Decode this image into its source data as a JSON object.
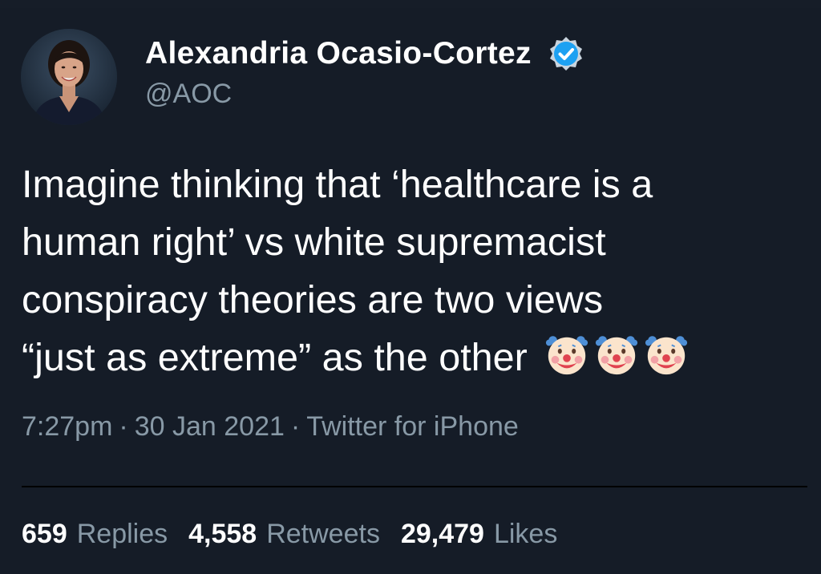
{
  "tweet": {
    "author": {
      "display_name": "Alexandria Ocasio-Cortez",
      "handle": "@AOC",
      "verified": true,
      "verified_color": "#1da1f2",
      "avatar_icon": "profile-photo"
    },
    "text_lines": [
      "Imagine thinking that ‘healthcare is a",
      "human right’ vs white supremacist",
      "conspiracy theories are two views",
      "“just as extreme” as the other"
    ],
    "emoji": [
      "🤡",
      "🤡",
      "🤡"
    ],
    "meta": {
      "time": "7:27pm",
      "date": "30 Jan 2021",
      "source": "Twitter for iPhone",
      "separator": "·"
    },
    "stats": [
      {
        "value": "659",
        "label": "Replies"
      },
      {
        "value": "4,558",
        "label": "Retweets"
      },
      {
        "value": "29,479",
        "label": "Likes"
      }
    ]
  },
  "colors": {
    "background": "#151c27",
    "primary_text": "#ffffff",
    "secondary_text": "#8899a6"
  }
}
